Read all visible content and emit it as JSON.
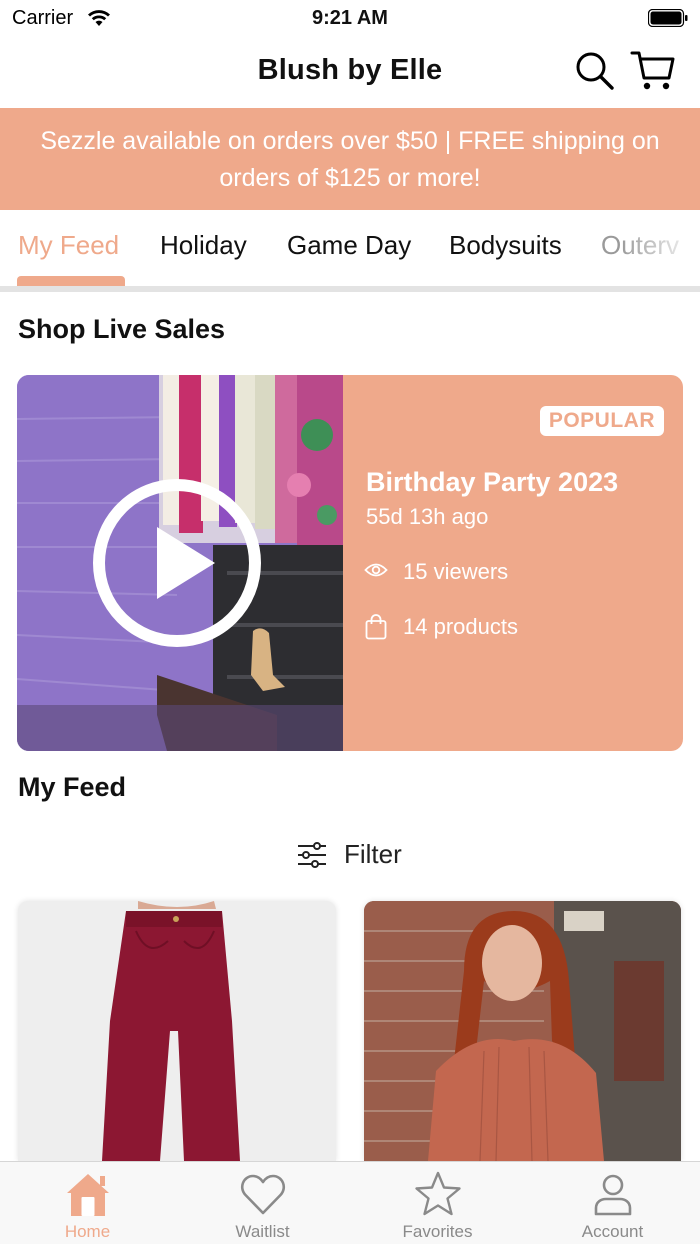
{
  "status_bar": {
    "carrier": "Carrier",
    "time": "9:21 AM"
  },
  "header": {
    "title": "Blush by Elle",
    "search_icon": "search-icon",
    "cart_icon": "cart-icon"
  },
  "banner": {
    "text": "Sezzle available on orders over $50 | FREE shipping on orders of $125 or more!"
  },
  "tabs": [
    {
      "label": "My Feed",
      "active": true
    },
    {
      "label": "Holiday",
      "active": false
    },
    {
      "label": "Game Day",
      "active": false
    },
    {
      "label": "Bodysuits",
      "active": false
    },
    {
      "label": "Outerv",
      "active": false
    }
  ],
  "live_section": {
    "title": "Shop Live Sales",
    "card": {
      "badge": "POPULAR",
      "title": "Birthday Party 2023",
      "ago": "55d 13h ago",
      "viewers": "15 viewers",
      "products": "14 products"
    }
  },
  "feed": {
    "title": "My Feed",
    "filter_label": "Filter"
  },
  "bottom_nav": [
    {
      "label": "Home",
      "icon": "home-icon",
      "active": true
    },
    {
      "label": "Waitlist",
      "icon": "heart-icon",
      "active": false
    },
    {
      "label": "Favorites",
      "icon": "star-icon",
      "active": false
    },
    {
      "label": "Account",
      "icon": "person-icon",
      "active": false
    }
  ],
  "colors": {
    "accent": "#efa98b",
    "inactive": "#8a8a8a",
    "text": "#111111"
  }
}
